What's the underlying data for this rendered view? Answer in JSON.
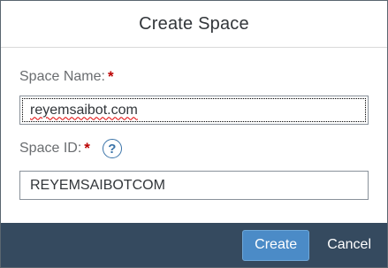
{
  "dialog": {
    "title": "Create Space",
    "space_name": {
      "label": "Space Name:",
      "required_marker": "*",
      "value": "reyemsaibot.com"
    },
    "space_id": {
      "label": "Space ID:",
      "required_marker": "*",
      "help_icon": "question-circle-icon",
      "help_glyph": "?",
      "value": "REYEMSAIBOTCOM"
    },
    "footer": {
      "create_label": "Create",
      "cancel_label": "Cancel"
    }
  },
  "colors": {
    "footer_bg": "#354a5f",
    "create_button": "#4b8bc7",
    "required": "#bb0000",
    "help_icon": "#3a73a8"
  }
}
